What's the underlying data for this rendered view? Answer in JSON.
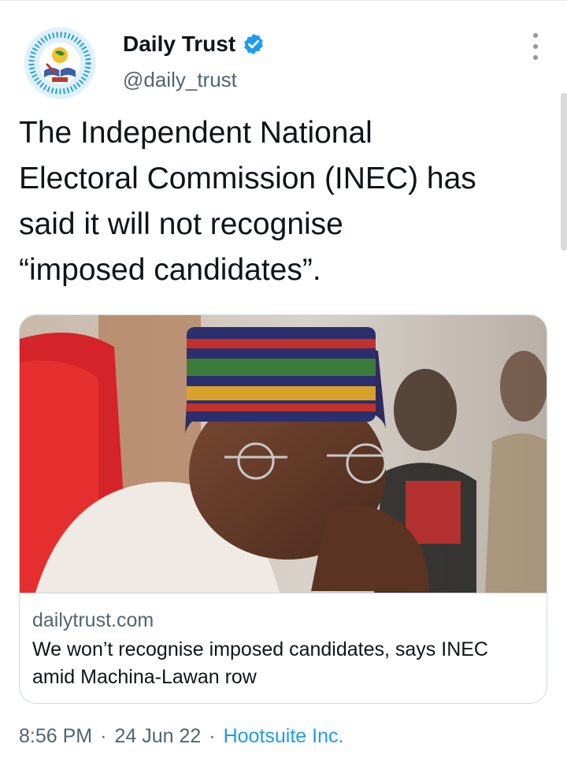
{
  "author": {
    "display_name": "Daily Trust",
    "handle": "@daily_trust",
    "verified": true,
    "avatar_icon": "globe-book-quill-logo"
  },
  "menu": {
    "icon": "more-vertical-icon"
  },
  "tweet": {
    "text": "The Independent National\nElectoral Commission (INEC) has\nsaid it will not recognise\n“imposed candidates”."
  },
  "card": {
    "domain": "dailytrust.com",
    "title": "We won’t recognise imposed candidates, says INEC amid Machina-Lawan row",
    "image_desc": "photo-man-in-cap-with-hands-clasped"
  },
  "meta": {
    "time": "8:56 PM",
    "separator": "·",
    "date": "24 Jun 22",
    "source": "Hootsuite Inc."
  },
  "colors": {
    "accent": "#1d9bf0",
    "text": "#0f1419",
    "secondary": "#536471",
    "border": "#cfd9de"
  }
}
